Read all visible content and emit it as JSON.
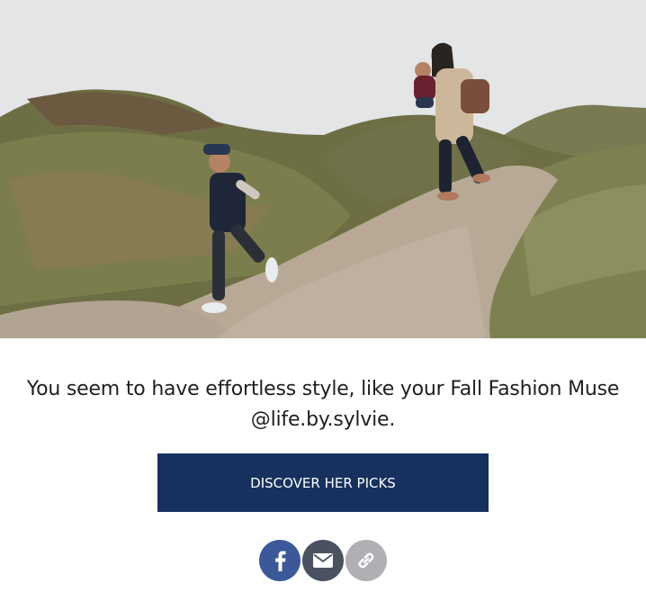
{
  "hero": {
    "alt": "Child walking down a sandy dune path while a woman carries a toddler behind him"
  },
  "message": {
    "text": "You seem to have effortless style, like your Fall Fashion Muse @life.by.sylvie."
  },
  "cta": {
    "label": "DISCOVER HER PICKS"
  },
  "share": {
    "buttons": [
      {
        "icon": "facebook-icon",
        "color": "#3b5998"
      },
      {
        "icon": "email-icon",
        "color": "#4a5160"
      },
      {
        "icon": "link-icon",
        "color": "#aeb0b4"
      }
    ]
  },
  "colors": {
    "cta_background": "#17315e",
    "text": "#1f1f1f"
  }
}
